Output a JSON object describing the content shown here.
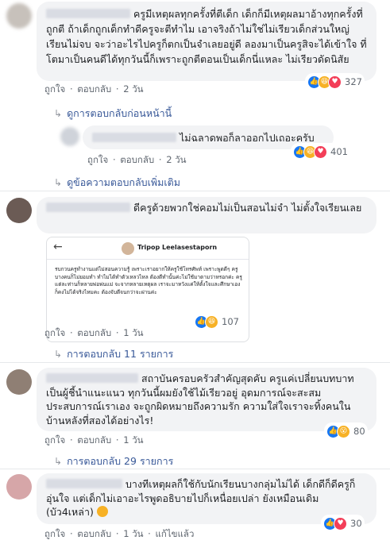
{
  "actions": {
    "like": "ถูกใจ",
    "reply": "ตอบกลับ",
    "dot": "·",
    "edit": "แก้ไขแล้ว"
  },
  "comments": [
    {
      "text": "ครูมีเหตุผลทุกครั้งที่ตีเด็ก เด็กก็มีเหตุผลมาอ้างทุกครั้งที่ถูกตี ถ้าเด็กถูกเด็กทำดีครูจะตีทำไม เอาจริงถ้าไม่ใช่ไม่เรียวเด็กส่วนใหญ่เรียนไม่จบ จะว่าอะไรไปครูก็ตกเป็นจำเลยอยู่ดี ลองมาเป็นครูสิจะได้เข้าใจ ที่โตมาเป็นคนดีได้ทุกวันนี้ก็เพราะถูกตีตอนเป็นเด็กนี่แหละ ไม่เรียวดัดนิสัย",
      "time": "2 วัน",
      "reaction_count": "327"
    },
    {
      "text": "ไม่ฉลาดพอก็ลาออกไปเถอะครับ",
      "time": "2 วัน",
      "reaction_count": "401"
    },
    {
      "text": "ดีครูด้วยพวกใช่คอมไม่เป็นสอนไม่จำ ไม่ตั้งใจเรียนเลย",
      "time": "1 วัน",
      "reaction_count": "107",
      "embed_name": "Tripop Leelasestaporn",
      "embed_text": "รบกวนครูทำงานแต่ไม่สอนความรู้ เพราะเราอยากให้ครูใช้โทรศัพท์ เพราะพูดดีๆ ครูบางคนก็ไม่ยอมทำ ทำไมได้ทำตัวเหลวไหล ต้องตีทำนั้นค่ะไม่ใช้มาตามว่าหรอกค่ะ ครูแต่ละท่านก็หลายพ่อพ่นแม่ จะจากหลายเหตุผล เราจะมาหวังแค่ให้ตั้งใจและศึกษาเองก็คงไม่ได้จริงไหมคะ ต้องจับตีจนกว่าจะผ่านค่ะ"
    },
    {
      "text": "สถาบันครอบครัวสำคัญสุดคับ ครูแค่เปลี่ยนบทบาทเป็นผู้ชี้นำแนะแนว ทุกวันนี้ผมยังใช้ไม้เรียวอยู่ อุดมการณ์จะสะสมประสบการณ์เราเอง จะถูกผิดหมายถึงความรัก ความใส่ใจเราจะทิ้งคนในบ้านหลังที่สองได้อย่างไร!",
      "time": "1 วัน",
      "reaction_count": "80"
    },
    {
      "text": "บางทีเหตุผลก็ใช้กับนักเรียนบางกลุ่มไม่ได้ เด็กดีก็ดีครูก็อุ่นใจ แต่เด็กไม่เอาอะไรพูดอธิบายไปก็เหนื่อยเปล่า ยังเหมือนเดิม (บัว4เหล่า)",
      "time": "1 วัน",
      "reaction_count": "30"
    }
  ],
  "links": {
    "see_previous": "ดูการตอบกลับก่อนหน้านี้",
    "see_more": "ดูข้อความตอบกลับเพิ่มเติม",
    "replies_11": "การตอบกลับ 11 รายการ",
    "replies_29": "การตอบกลับ 29 รายการ"
  },
  "colors": {
    "like": "#1877f2",
    "love": "#f33e58",
    "haha": "#f7b125",
    "link": "#385898"
  }
}
